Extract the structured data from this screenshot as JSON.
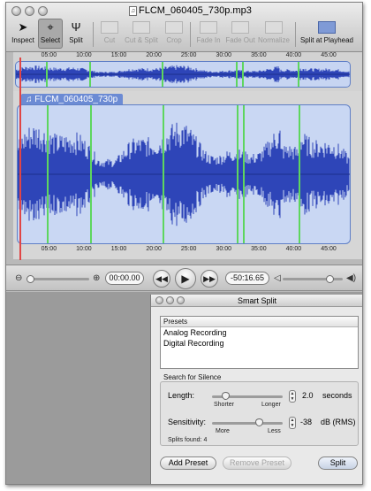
{
  "window": {
    "title": "FLCM_060405_730p.mp3",
    "traffic_lights": [
      "close",
      "minimize",
      "zoom"
    ]
  },
  "toolbar": {
    "tools": [
      {
        "label": "Inspect",
        "icon": "pointer-icon",
        "state": "enabled"
      },
      {
        "label": "Select",
        "icon": "crosshair-icon",
        "state": "selected"
      },
      {
        "label": "Split",
        "icon": "split-icon",
        "state": "enabled"
      },
      {
        "label": "Cut",
        "icon": "cut-icon",
        "state": "disabled"
      },
      {
        "label": "Cut & Split",
        "icon": "cut-split-icon",
        "state": "disabled"
      },
      {
        "label": "Crop",
        "icon": "crop-icon",
        "state": "disabled"
      },
      {
        "label": "Fade In",
        "icon": "fade-in-icon",
        "state": "disabled"
      },
      {
        "label": "Fade Out",
        "icon": "fade-out-icon",
        "state": "disabled"
      },
      {
        "label": "Normalize",
        "icon": "normalize-icon",
        "state": "disabled"
      },
      {
        "label": "Split at Playhead",
        "icon": "split-playhead-icon",
        "state": "enabled"
      }
    ]
  },
  "ruler": {
    "ticks": [
      "05:00",
      "10:00",
      "15:00",
      "20:00",
      "25:00",
      "30:00",
      "35:00",
      "40:00",
      "45:00"
    ]
  },
  "track": {
    "clip_name": "FLCM_060405_730p",
    "split_marker_count": 6
  },
  "transport": {
    "current_time": "00:00.00",
    "remaining_time": "-50:16.65",
    "zoom_level": 0.05,
    "volume_level": 0.8
  },
  "smart_split": {
    "title": "Smart Split",
    "presets_header": "Presets",
    "presets": [
      "Analog Recording",
      "Digital Recording"
    ],
    "group_label": "Search for Silence",
    "length_label": "Length:",
    "length_value": "2.0",
    "length_unit": "seconds",
    "length_min_label": "Shorter",
    "length_max_label": "Longer",
    "length_level": 0.2,
    "sensitivity_label": "Sensitivity:",
    "sensitivity_value": "-38",
    "sensitivity_unit": "dB (RMS)",
    "sensitivity_min_label": "More",
    "sensitivity_max_label": "Less",
    "sensitivity_level": 0.68,
    "splits_found": "Splits found: 4",
    "add_preset": "Add Preset",
    "remove_preset": "Remove Preset",
    "split_button": "Split"
  },
  "colors": {
    "waveform": "#2e45b8",
    "selection": "#c9d7f3",
    "split_marker": "#5ed65e",
    "playhead": "#e04545"
  }
}
